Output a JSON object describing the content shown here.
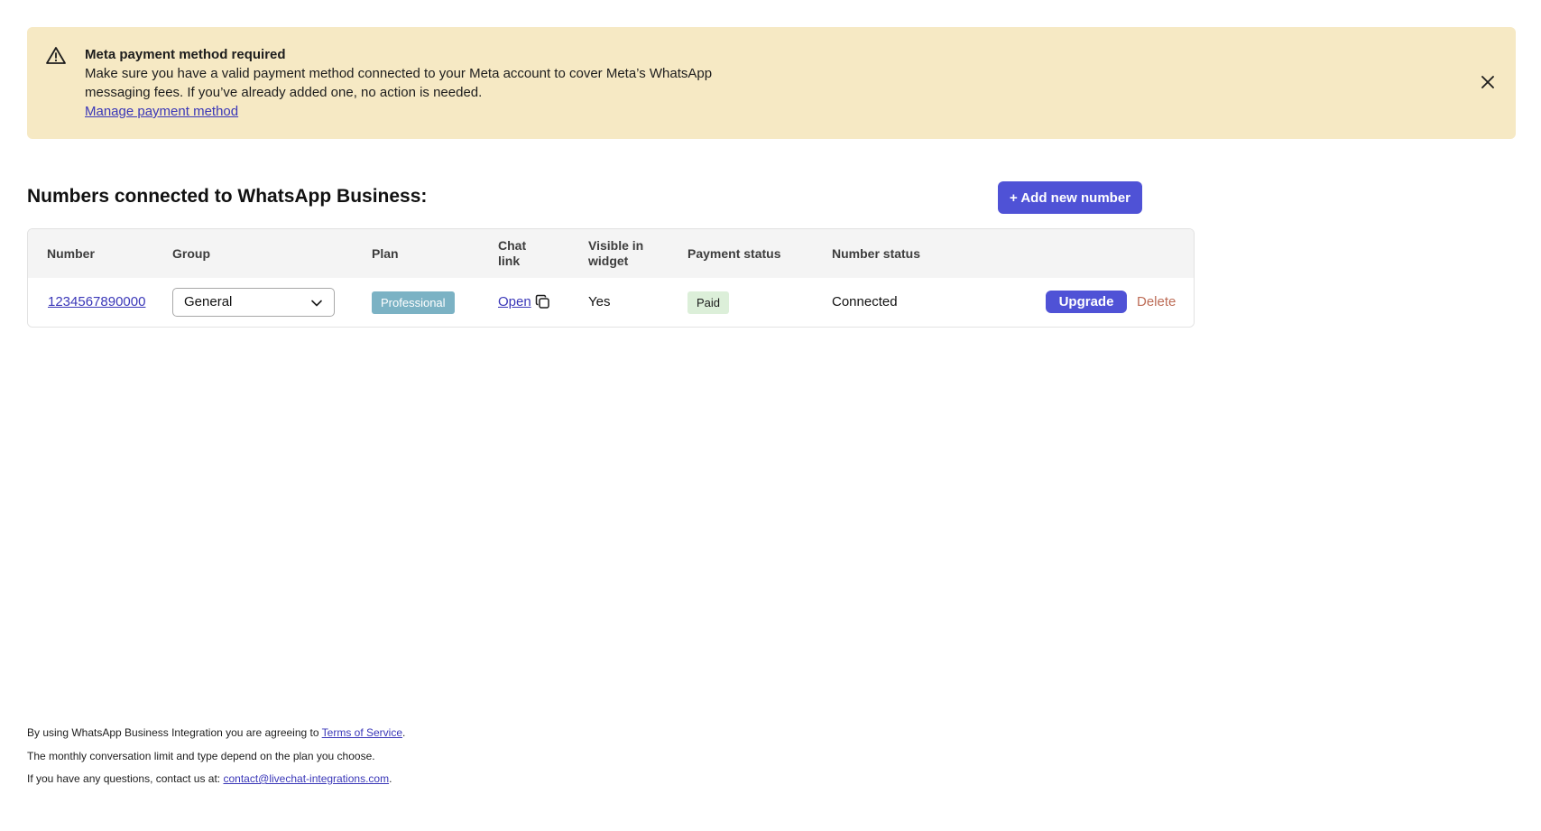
{
  "banner": {
    "icon": "warning-triangle-icon",
    "title": "Meta payment method required",
    "line1": "Make sure you have a valid payment method connected to your Meta account to cover Meta’s WhatsApp",
    "line2": "messaging fees. If you’ve already added one, no action is needed.",
    "link_label": "Manage payment method",
    "close_icon": "close-icon"
  },
  "section": {
    "title": "Numbers connected to WhatsApp Business:",
    "add_button_label": "+ Add new number"
  },
  "table": {
    "headers": {
      "number": "Number",
      "group": "Group",
      "plan": "Plan",
      "chat_link_1": "Chat",
      "chat_link_2": "link",
      "visible_1": "Visible in",
      "visible_2": "widget",
      "payment_status": "Payment status",
      "number_status": "Number status"
    },
    "rows": [
      {
        "number": "1234567890000",
        "group": "General",
        "plan": "Professional",
        "chat_link": "Open",
        "visible": "Yes",
        "payment_status": "Paid",
        "number_status": "Connected",
        "upgrade_label": "Upgrade",
        "delete_label": "Delete"
      }
    ]
  },
  "footer": {
    "line1_prefix": "By using WhatsApp Business Integration you are agreeing to ",
    "terms_label": "Terms of Service",
    "line1_suffix": ".",
    "line2": "The monthly conversation limit and type depend on the plan you choose.",
    "line3_prefix": "If you have any questions, contact us at: ",
    "contact_email": "contact@livechat-integrations.com",
    "line3_suffix": "."
  },
  "colors": {
    "banner_bg": "#f6e9c4",
    "primary": "#4f52d6",
    "link": "#3a37b8",
    "delete": "#bd6c56",
    "plan_badge": "#7bb2c4",
    "paid_badge": "#dcefd9"
  }
}
